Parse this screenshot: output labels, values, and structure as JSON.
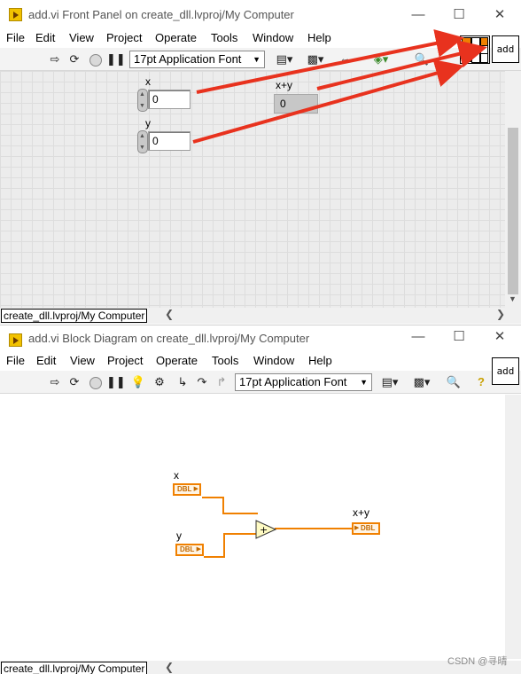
{
  "front_panel": {
    "title": "add.vi Front Panel on create_dll.lvproj/My Computer",
    "menu": [
      "File",
      "Edit",
      "View",
      "Project",
      "Operate",
      "Tools",
      "Window",
      "Help"
    ],
    "font_select": "17pt Application Font",
    "icon_text": "add",
    "controls": [
      {
        "label": "x",
        "value": "0"
      },
      {
        "label": "y",
        "value": "0"
      }
    ],
    "indicator": {
      "label": "x+y",
      "value": "0"
    },
    "status_path": "create_dll.lvproj/My Computer"
  },
  "block_diagram": {
    "title": "add.vi Block Diagram on create_dll.lvproj/My Computer",
    "menu": [
      "File",
      "Edit",
      "View",
      "Project",
      "Operate",
      "Tools",
      "Window",
      "Help"
    ],
    "font_select": "17pt Application Font",
    "icon_text": "add",
    "terminals": [
      {
        "label": "x",
        "type": "DBL"
      },
      {
        "label": "y",
        "type": "DBL"
      },
      {
        "label": "x+y",
        "type": "DBL"
      }
    ],
    "add_symbol": "+",
    "status_path": "create_dll.lvproj/My Computer"
  },
  "watermark": "CSDN @寻晴",
  "colors": {
    "annotation_arrow": "#e8321e",
    "dbl_wire": "#f08000",
    "panel_bg": "#ececec"
  }
}
